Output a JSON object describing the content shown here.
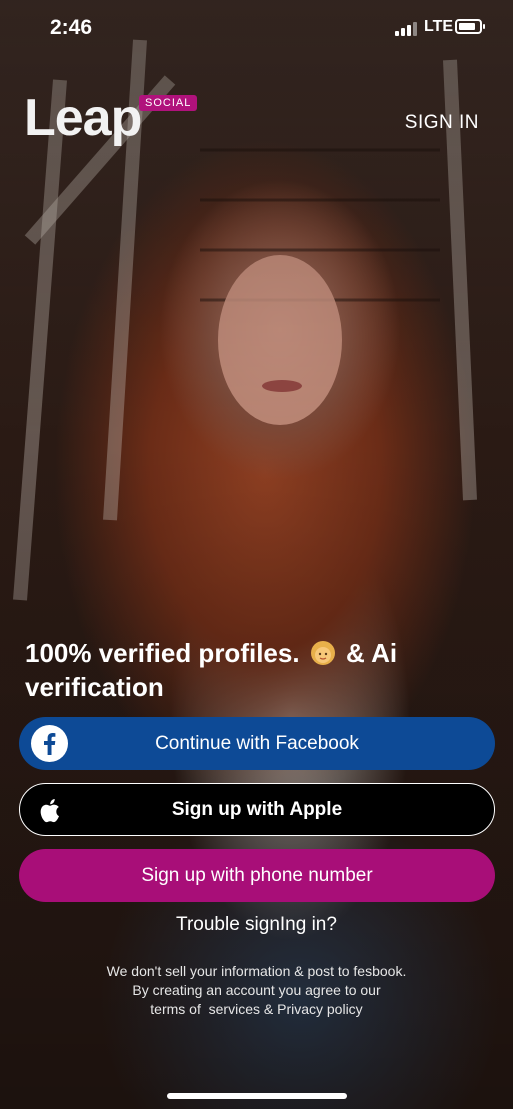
{
  "status_bar": {
    "time": "2:46",
    "network": "LTE"
  },
  "header": {
    "logo": "Leap",
    "logo_badge": "SOCIAL",
    "sign_in": "SIGN IN"
  },
  "headline": {
    "line_start": "100% verified profiles.",
    "line_end": "& Ai verification"
  },
  "buttons": {
    "facebook": "Continue with Facebook",
    "apple": "Sign up with Apple",
    "phone": "Sign up with phone number"
  },
  "trouble": "Trouble signIng in?",
  "legal": {
    "line1": "We don't sell your information & post to fesbook.",
    "line2": "By creating an account you agree to our",
    "line3": "terms of  services & Privacy policy"
  },
  "colors": {
    "facebook": "#0d4a96",
    "apple": "#000000",
    "phone": "#a80e78",
    "badge": "#b0127c"
  }
}
